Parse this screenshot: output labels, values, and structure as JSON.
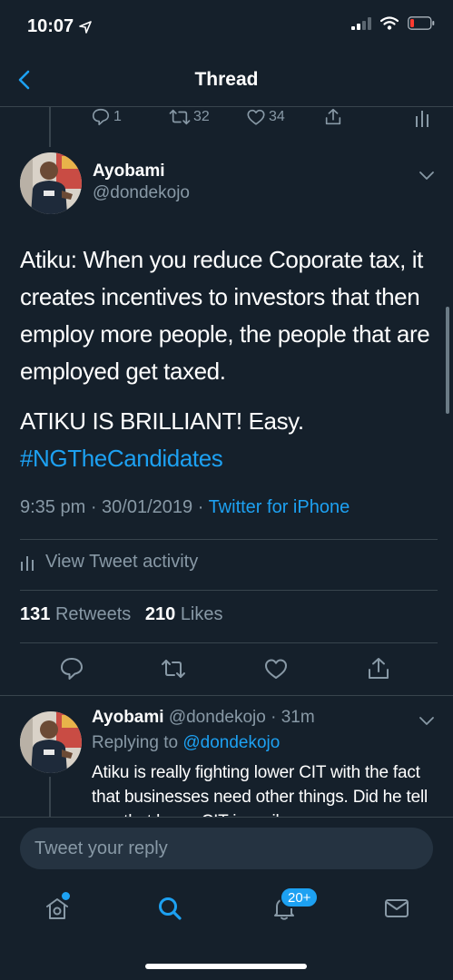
{
  "status_bar": {
    "time": "10:07"
  },
  "header": {
    "title": "Thread"
  },
  "previous_tweet": {
    "replies": "1",
    "retweets": "32",
    "likes": "34"
  },
  "main_tweet": {
    "author_name": "Ayobami",
    "author_handle": "@dondekojo",
    "text_paragraph1": "Atiku: When you reduce Coporate tax, it creates incentives to investors that then employ more people, the people that are employed get taxed.",
    "text_paragraph2_line1": "ATIKU IS BRILLIANT! Easy.",
    "hashtag": "#NGTheCandidates",
    "timestamp": "9:35 pm · 30/01/2019 ·",
    "source": "Twitter for iPhone",
    "view_activity": "View Tweet activity",
    "retweets_count": "131",
    "retweets_label": "Retweets",
    "likes_count": "210",
    "likes_label": "Likes"
  },
  "reply_tweet": {
    "author_name": "Ayobami",
    "author_handle_time": "@dondekojo · 31m",
    "replying_to_label": "Replying to",
    "replying_to_handle": "@dondekojo",
    "text": "Atiku is really fighting lower CIT with the fact that businesses need other things. Did he tell you that lower CIT is a silver"
  },
  "composer": {
    "placeholder": "Tweet your reply"
  },
  "tab_bar": {
    "notifications_badge": "20+"
  },
  "colors": {
    "background": "#15202b",
    "accent": "#1da1f2",
    "muted": "#8899a6",
    "divider": "#38444d"
  },
  "icons": [
    "location-arrow-icon",
    "signal-icon",
    "wifi-icon",
    "battery-icon",
    "back-arrow-icon",
    "reply-icon",
    "retweet-icon",
    "like-icon",
    "share-icon",
    "analytics-icon",
    "chevron-down-icon",
    "home-icon",
    "search-icon",
    "notifications-icon",
    "messages-icon"
  ]
}
